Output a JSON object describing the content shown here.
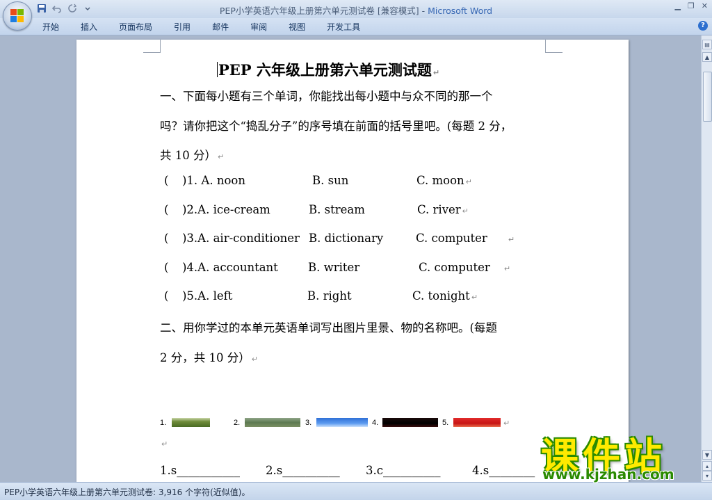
{
  "window": {
    "title": "PEP小学英语六年级上册第六单元测试卷 [兼容模式] - ",
    "app_name": "Microsoft Word",
    "controls": [
      "▁",
      "❐",
      "✕"
    ]
  },
  "quick_access": [
    "save-icon",
    "undo-icon",
    "redo-icon",
    "customize-icon"
  ],
  "ribbon_tabs": [
    "开始",
    "插入",
    "页面布局",
    "引用",
    "邮件",
    "审阅",
    "视图",
    "开发工具"
  ],
  "document": {
    "title": "PEP 六年级上册第六单元测试题",
    "section1": {
      "line1": "一、下面每小题有三个单词，你能找出每小题中与众不同的那一个",
      "line2": "吗？请你把这个“捣乱分子”的序号填在前面的括号里吧。(每题 2 分，",
      "line3": "共 10 分）"
    },
    "questions": [
      {
        "bracket": "(",
        "num": ")1. A. noon",
        "b": "B. sun",
        "c": "C. moon"
      },
      {
        "bracket": "(",
        "num": ")2.A. ice-cream",
        "b": "B. stream",
        "c": "C. river"
      },
      {
        "bracket": "(",
        "num": ")3.A. air-conditioner",
        "b": "B. dictionary",
        "c": "C. computer"
      },
      {
        "bracket": "(",
        "num": ")4.A. accountant",
        "b": "B. writer",
        "c": "C. computer"
      },
      {
        "bracket": "(",
        "num": ")5.A. left",
        "b": "B. right",
        "c": "C. tonight"
      }
    ],
    "section2": {
      "line1": "二、用你学过的本单元英语单词写出图片里景、物的名称吧。(每题",
      "line2": "2 分，共 10 分）"
    },
    "picture_labels": [
      "1.",
      "2.",
      "3.",
      "4.",
      "5."
    ],
    "answer_blanks": [
      "1.s___________",
      "2.s__________",
      "3.c__________",
      "4.s________"
    ]
  },
  "status_bar": {
    "text": "PEP小学英语六年级上册第六单元测试卷: 3,916 个字符(近似值)。"
  },
  "watermark": {
    "main": "课件站",
    "url": "www.kjzhan.com"
  },
  "colors": {
    "accent": "#3566b3",
    "page": "#ffffff",
    "workspace": "#a9b7cc",
    "watermark_yellow": "#ffea00",
    "watermark_green": "#2a8a00"
  }
}
